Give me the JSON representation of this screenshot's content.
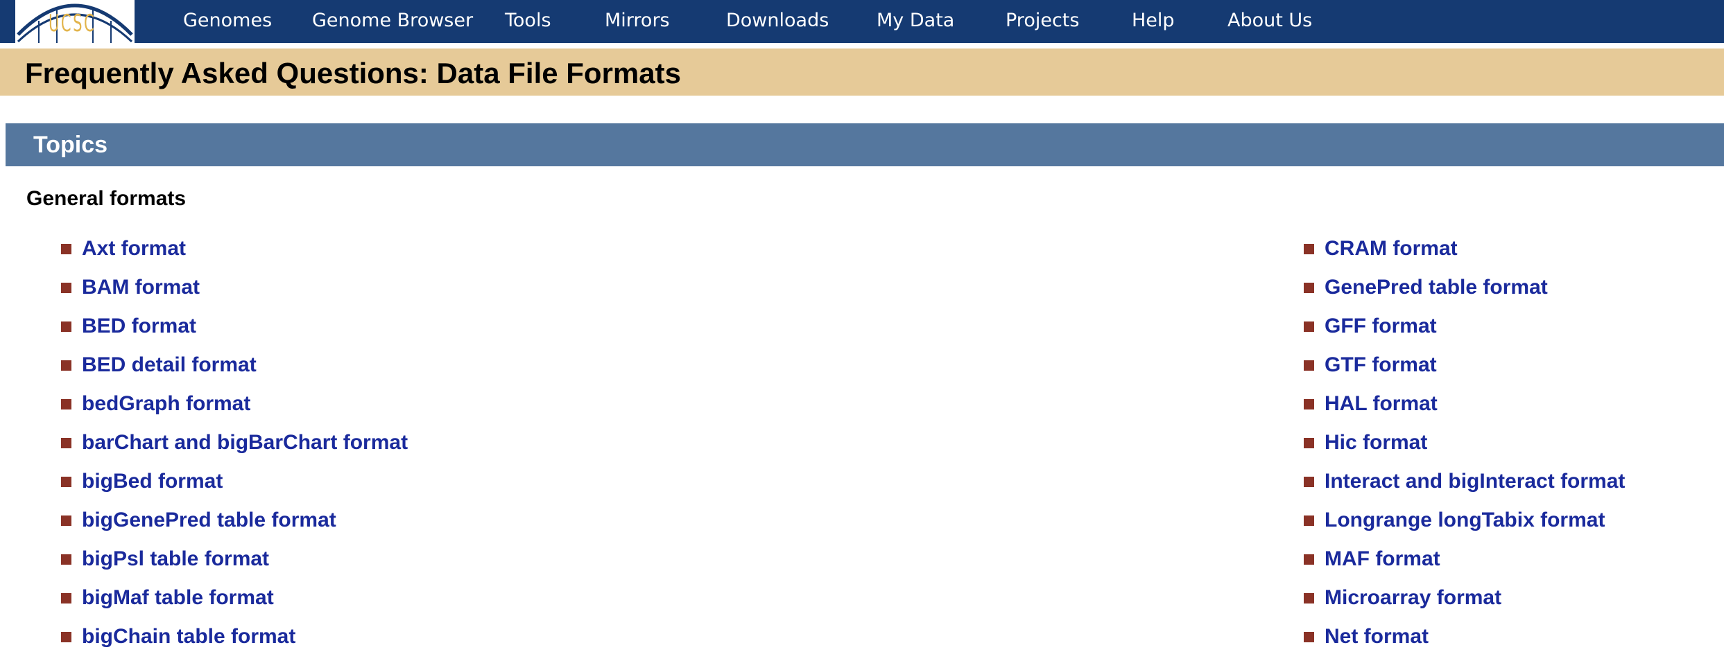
{
  "logo": {
    "text": "UCSC"
  },
  "nav": {
    "items": [
      {
        "label": "Genomes"
      },
      {
        "label": "Genome Browser"
      },
      {
        "label": "Tools"
      },
      {
        "label": "Mirrors"
      },
      {
        "label": "Downloads"
      },
      {
        "label": "My Data"
      },
      {
        "label": "Projects"
      },
      {
        "label": "Help"
      },
      {
        "label": "About Us"
      }
    ]
  },
  "page": {
    "title": "Frequently Asked Questions: Data File Formats"
  },
  "topics": {
    "title": "Topics",
    "section_label": "General formats",
    "left_column": [
      {
        "label": "Axt format"
      },
      {
        "label": "BAM format"
      },
      {
        "label": "BED format"
      },
      {
        "label": "BED detail format"
      },
      {
        "label": "bedGraph format"
      },
      {
        "label": "barChart and bigBarChart format"
      },
      {
        "label": "bigBed format"
      },
      {
        "label": "bigGenePred table format"
      },
      {
        "label": "bigPsl table format"
      },
      {
        "label": "bigMaf table format"
      },
      {
        "label": "bigChain table format"
      }
    ],
    "right_column": [
      {
        "label": "CRAM format"
      },
      {
        "label": "GenePred table format"
      },
      {
        "label": "GFF format"
      },
      {
        "label": "GTF format"
      },
      {
        "label": "HAL format"
      },
      {
        "label": "Hic format"
      },
      {
        "label": "Interact and bigInteract format"
      },
      {
        "label": "Longrange longTabix format"
      },
      {
        "label": "MAF format"
      },
      {
        "label": "Microarray format"
      },
      {
        "label": "Net format"
      }
    ]
  },
  "colors": {
    "navbar_bg": "#153a72",
    "title_banner_bg": "#e6ca98",
    "topics_header_bg": "#55779e",
    "link": "#1a2a9c",
    "bullet": "#8a3226",
    "logo_gold": "#e2b44c"
  }
}
